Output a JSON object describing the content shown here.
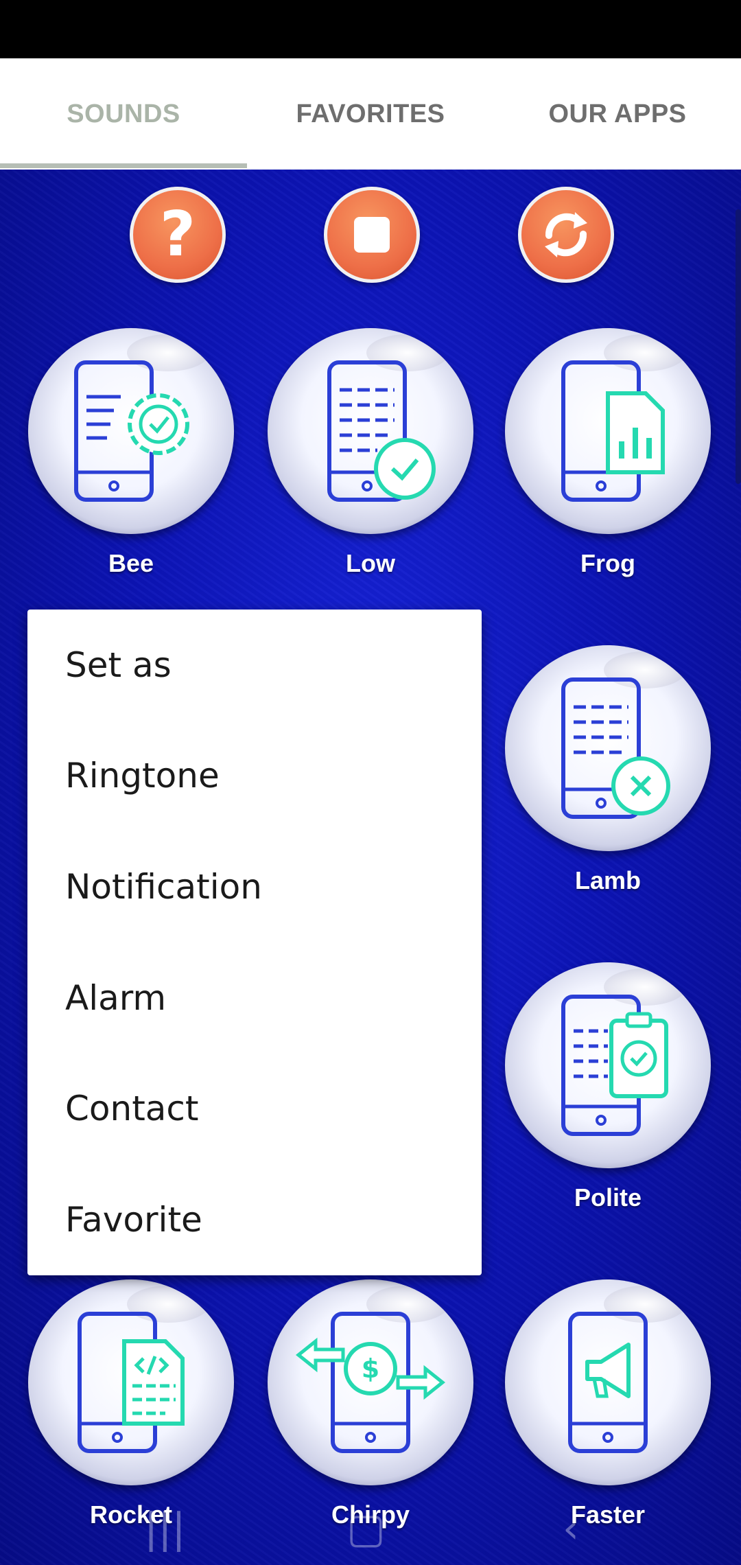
{
  "tabs": [
    {
      "label": "SOUNDS",
      "active": true
    },
    {
      "label": "FAVORITES",
      "active": false
    },
    {
      "label": "OUR APPS",
      "active": false
    }
  ],
  "controls": {
    "help_icon": "question-mark",
    "stop_icon": "stop-square",
    "shuffle_icon": "refresh-arrows",
    "accent_color": "#ee6f48"
  },
  "sounds": [
    {
      "label": "Bee",
      "icon": "phone-gear-icon"
    },
    {
      "label": "Low",
      "icon": "phone-check-icon"
    },
    {
      "label": "Frog",
      "icon": "phone-chart-icon"
    },
    {
      "label": "Lamb",
      "icon": "phone-x-icon"
    },
    {
      "label": "Polite",
      "icon": "phone-clipboard-icon"
    },
    {
      "label": "Rocket",
      "icon": "phone-code-icon"
    },
    {
      "label": "Chirpy",
      "icon": "phone-money-transfer-icon"
    },
    {
      "label": "Faster",
      "icon": "phone-megaphone-icon"
    }
  ],
  "menu": {
    "title": "Set as",
    "items": [
      "Ringtone",
      "Notification",
      "Alarm",
      "Contact",
      "Favorite"
    ]
  },
  "colors": {
    "background": "#0c14b6",
    "icon_blue": "#2b3fd6",
    "icon_teal": "#25d9b0"
  }
}
